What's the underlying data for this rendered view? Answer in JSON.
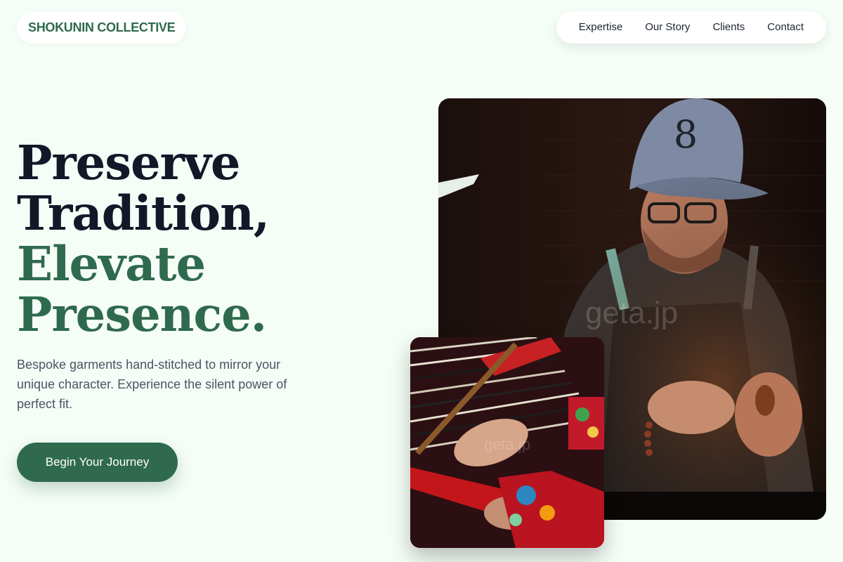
{
  "brand": {
    "name": "SHOKUNIN COLLECTIVE"
  },
  "nav": {
    "items": [
      {
        "label": "Expertise"
      },
      {
        "label": "Our Story"
      },
      {
        "label": "Clients"
      },
      {
        "label": "Contact"
      }
    ]
  },
  "hero": {
    "headline_line1": "Preserve",
    "headline_line2": "Tradition,",
    "headline_line3": "Elevate",
    "headline_line4": "Presence.",
    "subtext": "Bespoke garments hand-stitched to mirror your unique character. Experience the silent power of perfect fit.",
    "cta_label": "Begin Your Journey"
  },
  "images": {
    "main_watermark": "geta.jp",
    "secondary_watermark": "geta.jp"
  },
  "colors": {
    "background": "#f5fdf7",
    "accent": "#2f6a4f",
    "heading_dark": "#111827"
  }
}
